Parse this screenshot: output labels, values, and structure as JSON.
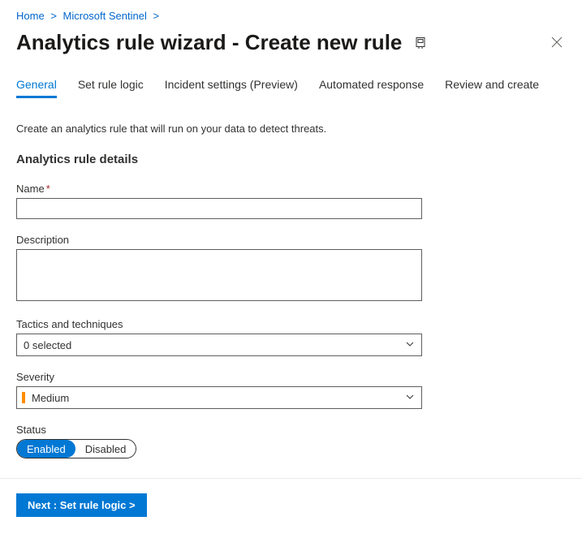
{
  "breadcrumb": {
    "home": "Home",
    "sentinel": "Microsoft Sentinel"
  },
  "title": "Analytics rule wizard - Create new rule",
  "tabs": {
    "general": "General",
    "logic": "Set rule logic",
    "incident": "Incident settings (Preview)",
    "automated": "Automated response",
    "review": "Review and create"
  },
  "intro": "Create an analytics rule that will run on your data to detect threats.",
  "section_title": "Analytics rule details",
  "fields": {
    "name_label": "Name",
    "name_value": "",
    "description_label": "Description",
    "description_value": "",
    "tactics_label": "Tactics and techniques",
    "tactics_selected": "0 selected",
    "severity_label": "Severity",
    "severity_value": "Medium",
    "status_label": "Status",
    "status_enabled": "Enabled",
    "status_disabled": "Disabled"
  },
  "footer": {
    "next": "Next : Set rule logic >"
  }
}
